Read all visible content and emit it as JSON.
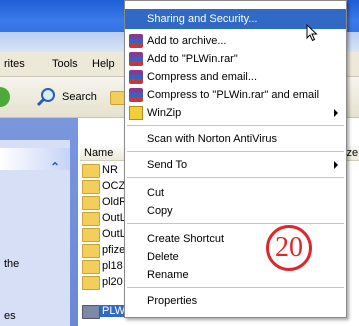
{
  "menubar": {
    "items": [
      "rites",
      "Tools",
      "Help"
    ]
  },
  "toolbar": {
    "search_label": "Search"
  },
  "taskpane": {
    "texts": [
      "the",
      "es"
    ]
  },
  "list": {
    "col_name": "Name",
    "col_size": "ize",
    "files": [
      "NR",
      "OCZ",
      "OldR",
      "OutL",
      "OutL",
      "pfizer",
      "pl18",
      "pl20",
      "PLWin"
    ]
  },
  "context_menu": {
    "items": [
      "Sharing and Security...",
      "Add to archive...",
      "Add to \"PLWin.rar\"",
      "Compress and email...",
      "Compress to \"PLWin.rar\" and email",
      "WinZip",
      "Scan with Norton AntiVirus",
      "Send To",
      "Cut",
      "Copy",
      "Create Shortcut",
      "Delete",
      "Rename",
      "Properties"
    ]
  },
  "step_badge": "20",
  "colors": {
    "highlight": "#316ac5",
    "badge": "#e0262b"
  },
  "icons": [
    "search-icon",
    "folder-icon",
    "rar-archive-icon",
    "winzip-icon",
    "mouse-cursor-icon",
    "collapse-chevron-icon",
    "submenu-arrow-icon"
  ]
}
